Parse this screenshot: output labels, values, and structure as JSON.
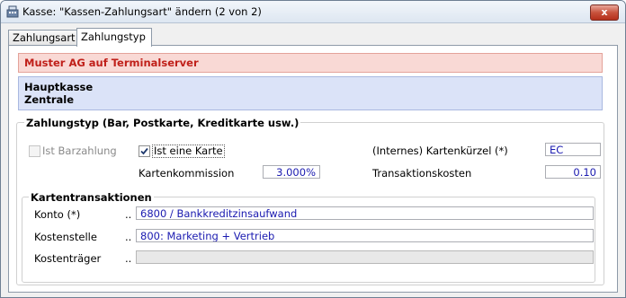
{
  "window": {
    "title": "Kasse: \"Kassen-Zahlungsart\" ändern (2 von 2)",
    "close_glyph": "x"
  },
  "tabs": [
    {
      "label": "Zahlungsart"
    },
    {
      "label": "Zahlungstyp"
    }
  ],
  "context": {
    "company": "Muster AG auf Terminalserver",
    "register_line1": "Hauptkasse",
    "register_line2": "Zentrale"
  },
  "group": {
    "title": "Zahlungstyp (Bar, Postkarte, Kreditkarte usw.)",
    "ist_barzahlung": {
      "label": "Ist Barzahlung",
      "checked": false,
      "enabled": false
    },
    "ist_karte": {
      "label": "Ist eine Karte",
      "checked": true,
      "enabled": true
    },
    "kartenkuerzel": {
      "label": "(Internes) Kartenkürzel (*)",
      "value": "EC"
    },
    "kartenkommission": {
      "label": "Kartenkommission",
      "value": "3.000%"
    },
    "transaktionskosten": {
      "label": "Transaktionskosten",
      "value": "0.10"
    }
  },
  "kartentransaktionen": {
    "title": "Kartentransaktionen",
    "konto": {
      "label": "Konto (*)",
      "dots": "..",
      "value": "6800 / Bankkreditzinsaufwand"
    },
    "kostenstelle": {
      "label": "Kostenstelle",
      "dots": "..",
      "value": "800: Marketing + Vertrieb"
    },
    "kostentraeger": {
      "label": "Kostenträger",
      "dots": "..",
      "value": ""
    }
  },
  "colors": {
    "company_bar": "#f9d9d5",
    "company_text": "#c0201a",
    "register_bar": "#dbe3f8",
    "field_text": "#1a1ab0",
    "close_button": "#c8523d"
  }
}
